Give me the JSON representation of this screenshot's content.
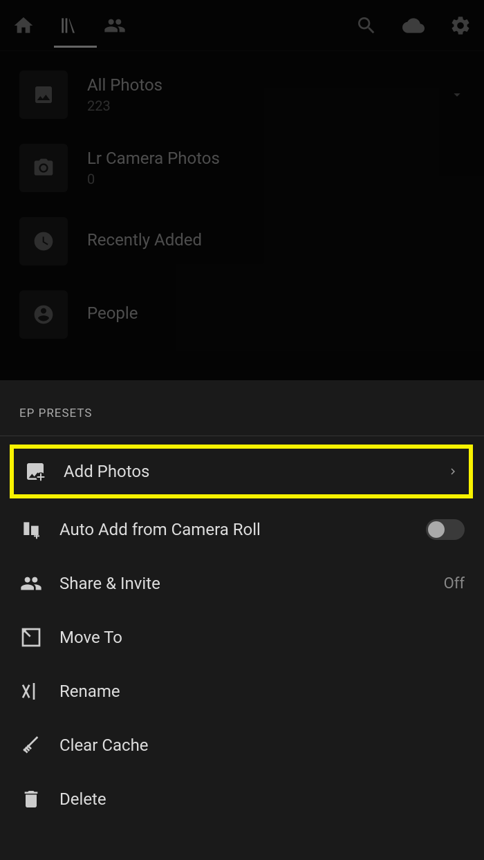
{
  "library": {
    "items": [
      {
        "title": "All Photos",
        "count": "223",
        "icon": "image",
        "chevron": true
      },
      {
        "title": "Lr Camera Photos",
        "count": "0",
        "icon": "camera",
        "chevron": false
      },
      {
        "title": "Recently Added",
        "count": "",
        "icon": "clock",
        "chevron": false
      },
      {
        "title": "People",
        "count": "",
        "icon": "person",
        "chevron": false
      }
    ]
  },
  "sheet": {
    "title": "EP PRESETS",
    "menu": [
      {
        "label": "Add Photos",
        "right_type": "chevron",
        "highlighted": true
      },
      {
        "label": "Auto Add from Camera Roll",
        "right_type": "toggle"
      },
      {
        "label": "Share & Invite",
        "right_type": "text",
        "right_text": "Off"
      },
      {
        "label": "Move To",
        "right_type": "none"
      },
      {
        "label": "Rename",
        "right_type": "none"
      },
      {
        "label": "Clear Cache",
        "right_type": "none"
      },
      {
        "label": "Delete",
        "right_type": "none"
      }
    ]
  }
}
